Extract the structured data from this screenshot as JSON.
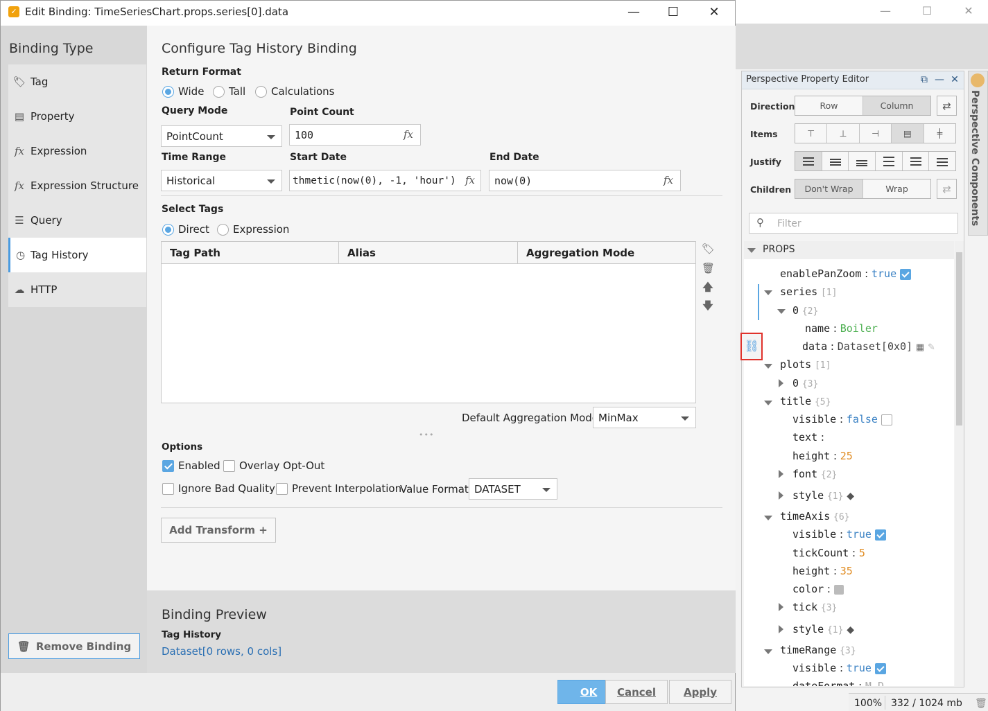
{
  "dialog": {
    "title": "Edit Binding: TimeSeriesChart.props.series[0].data",
    "buttons": {
      "minimize": "—",
      "maximize": "☐",
      "close": "✕"
    }
  },
  "binding_type": {
    "title": "Binding Type",
    "items": [
      {
        "label": "Tag",
        "icon": "tag-icon"
      },
      {
        "label": "Property",
        "icon": "property-icon"
      },
      {
        "label": "Expression",
        "icon": "fx-icon"
      },
      {
        "label": "Expression Structure",
        "icon": "fx-icon"
      },
      {
        "label": "Query",
        "icon": "database-icon"
      },
      {
        "label": "Tag History",
        "icon": "clock-icon",
        "selected": true
      },
      {
        "label": "HTTP",
        "icon": "cloud-icon"
      }
    ],
    "remove_label": "Remove Binding"
  },
  "config": {
    "title": "Configure Tag History Binding",
    "return_format": {
      "label": "Return Format",
      "options": [
        "Wide",
        "Tall",
        "Calculations"
      ],
      "selected": "Wide"
    },
    "query_mode": {
      "label": "Query Mode",
      "value": "PointCount"
    },
    "point_count": {
      "label": "Point Count",
      "value": "100"
    },
    "time_range": {
      "label": "Time Range",
      "value": "Historical"
    },
    "start_date": {
      "label": "Start Date",
      "value": "thmetic(now(0), -1, 'hour')"
    },
    "end_date": {
      "label": "End Date",
      "value": "now(0)"
    },
    "fx_symbol": "fx",
    "select_tags": {
      "label": "Select Tags",
      "options": [
        "Direct",
        "Expression"
      ],
      "selected": "Direct"
    },
    "table": {
      "columns": [
        "Tag Path",
        "Alias",
        "Aggregation Mode"
      ],
      "rows": []
    },
    "default_aggregation": {
      "label": "Default Aggregation Mode",
      "value": "MinMax"
    },
    "grip": "•••",
    "options": {
      "label": "Options",
      "enabled": {
        "label": "Enabled",
        "checked": true
      },
      "overlay_opt_out": {
        "label": "Overlay Opt-Out",
        "checked": false
      },
      "ignore_bad_quality": {
        "label": "Ignore Bad Quality",
        "checked": false
      },
      "prevent_interpolation": {
        "label": "Prevent Interpolation",
        "checked": false
      },
      "value_format": {
        "label": "Value Format",
        "value": "DATASET"
      }
    },
    "add_transform_label": "Add Transform +"
  },
  "preview": {
    "title": "Binding Preview",
    "subtitle": "Tag History",
    "value": "Dataset[0 rows, 0 cols]"
  },
  "footer": {
    "ok": "OK",
    "cancel": "Cancel",
    "apply": "Apply"
  },
  "property_editor": {
    "title": "Perspective Property Editor",
    "direction": {
      "label": "Direction",
      "options": [
        "Row",
        "Column"
      ],
      "selected": "Column"
    },
    "items_label": "Items",
    "justify_label": "Justify",
    "children": {
      "label": "Children",
      "options": [
        "Don't Wrap",
        "Wrap"
      ],
      "selected": "Don't Wrap"
    },
    "filter_placeholder": "Filter",
    "section": "PROPS",
    "tree": {
      "enablePanZoom": {
        "key": "enablePanZoom",
        "value": "true"
      },
      "series": {
        "key": "series",
        "count": "[1]"
      },
      "series0": {
        "key": "0",
        "count": "{2}"
      },
      "name": {
        "key": "name",
        "value": "Boiler"
      },
      "data": {
        "key": "data",
        "value": "Dataset[0x0]"
      },
      "plots": {
        "key": "plots",
        "count": "[1]"
      },
      "plots0": {
        "key": "0",
        "count": "{3}"
      },
      "title": {
        "key": "title",
        "count": "{5}"
      },
      "title_visible": {
        "key": "visible",
        "value": "false"
      },
      "title_text": {
        "key": "text",
        "value": ""
      },
      "title_height": {
        "key": "height",
        "value": "25"
      },
      "title_font": {
        "key": "font",
        "count": "{2}"
      },
      "title_style": {
        "key": "style",
        "count": "{1}"
      },
      "timeAxis": {
        "key": "timeAxis",
        "count": "{6}"
      },
      "ta_visible": {
        "key": "visible",
        "value": "true"
      },
      "ta_tickCount": {
        "key": "tickCount",
        "value": "5"
      },
      "ta_height": {
        "key": "height",
        "value": "35"
      },
      "ta_color": {
        "key": "color"
      },
      "ta_tick": {
        "key": "tick",
        "count": "{3}"
      },
      "ta_style": {
        "key": "style",
        "count": "{1}"
      },
      "timeRange": {
        "key": "timeRange",
        "count": "{3}"
      },
      "tr_visible": {
        "key": "visible",
        "value": "true"
      },
      "tr_dateFormat": {
        "key": "dateFormat",
        "value": "M D"
      }
    },
    "side_tab": "Perspective Components"
  },
  "status": {
    "zoom": "100%",
    "memory": "332 / 1024 mb"
  },
  "colors": {
    "accent": "#5aa6e2",
    "string": "#4caf50",
    "boolean": "#3b82c4",
    "number": "#e08a1e",
    "highlight": "#e0322b"
  }
}
